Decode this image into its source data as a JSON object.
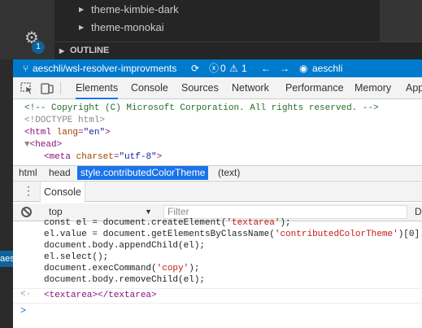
{
  "vscode": {
    "tree_items": [
      "theme-kimbie-dark",
      "theme-monokai"
    ],
    "outline_label": "OUTLINE",
    "notification_count": "1",
    "peek_text": "aes"
  },
  "statusbar": {
    "branch": "aeschli/wsl-resolver-improvments",
    "errors": "0",
    "warnings": "1",
    "user": "aeschli"
  },
  "devtools": {
    "tabs": [
      "Elements",
      "Console",
      "Sources",
      "Network",
      "Performance",
      "Memory",
      "App"
    ],
    "active_tab": "Elements",
    "elements_lines": {
      "comment": "<!-- Copyright (C) Microsoft Corporation. All rights reserved. -->",
      "doctype": "<!DOCTYPE html>",
      "html_open": "<html",
      "lang_attr": "lang",
      "lang_val": "\"en\"",
      "html_close": ">",
      "head": "<head>",
      "meta_open": "<meta",
      "charset_attr": "charset",
      "charset_val": "\"utf-8\"",
      "meta_close": ">"
    },
    "breadcrumbs": [
      "html",
      "head",
      "style.contributedColorTheme",
      "(text)"
    ],
    "drawer_tab": "Console",
    "console_toolbar": {
      "context": "top",
      "filter_placeholder": "Filter",
      "levels": "D"
    },
    "console_lines": [
      {
        "pre": "const el = document.createElement(",
        "str": "'textarea'",
        "post": ");"
      },
      {
        "pre": "el.value = document.getElementsByClassName(",
        "str": "'contributedColorTheme'",
        "post": ")[0]."
      },
      {
        "pre": "document.body.appendChild(el);",
        "str": "",
        "post": ""
      },
      {
        "pre": "el.select();",
        "str": "",
        "post": ""
      },
      {
        "pre": "document.execCommand(",
        "str": "'copy'",
        "post": ");"
      },
      {
        "pre": "document.body.removeChild(el);",
        "str": "",
        "post": ""
      }
    ],
    "console_result": "<textarea></textarea>",
    "prompt_symbol": ">",
    "return_symbol": "<·"
  }
}
